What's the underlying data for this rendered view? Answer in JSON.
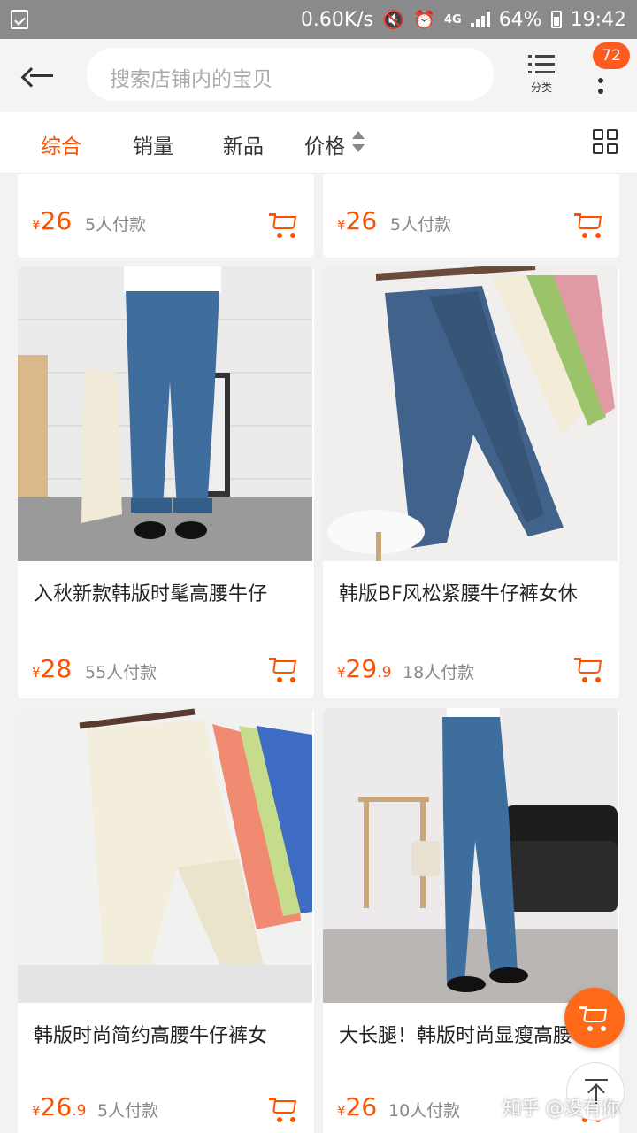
{
  "status_bar": {
    "speed": "0.60K/s",
    "network": "4G",
    "battery": "64%",
    "time": "19:42"
  },
  "header": {
    "search_placeholder": "搜索店铺内的宝贝",
    "category_label": "分类",
    "badge_count": "72"
  },
  "filters": {
    "tabs": [
      "综合",
      "销量",
      "新品",
      "价格"
    ],
    "active": "综合"
  },
  "products": [
    {
      "title": "",
      "price_int": "26",
      "price_dec": "",
      "sales": "5人付款"
    },
    {
      "title": "",
      "price_int": "26",
      "price_dec": "",
      "sales": "5人付款"
    },
    {
      "title": "入秋新款韩版时髦高腰牛仔",
      "price_int": "28",
      "price_dec": "",
      "sales": "55人付款"
    },
    {
      "title": "韩版BF风松紧腰牛仔裤女休",
      "price_int": "29",
      "price_dec": ".9",
      "sales": "18人付款"
    },
    {
      "title": "韩版时尚简约高腰牛仔裤女",
      "price_int": "26",
      "price_dec": ".9",
      "sales": "5人付款"
    },
    {
      "title": "大长腿！韩版时尚显瘦高腰",
      "price_int": "26",
      "price_dec": "",
      "sales": "10人付款"
    }
  ],
  "currency": "¥",
  "watermark": "知乎 @没有你",
  "colors": {
    "accent": "#ff5000",
    "status_bar": "#8a8a8a"
  }
}
